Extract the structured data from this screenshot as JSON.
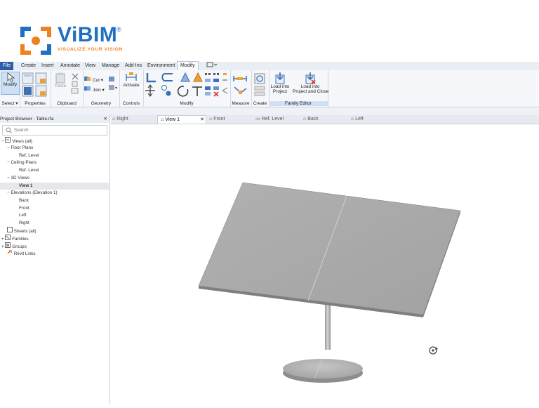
{
  "brand": {
    "name": "ViBIM",
    "reg": "®",
    "tagline": "VISUALIZE YOUR VISION"
  },
  "menu": [
    {
      "label": "File"
    },
    {
      "label": "Create"
    },
    {
      "label": "Insert"
    },
    {
      "label": "Annotate"
    },
    {
      "label": "View"
    },
    {
      "label": "Manage"
    },
    {
      "label": "Add-Ins"
    },
    {
      "label": "Environment"
    },
    {
      "label": "Modify"
    }
  ],
  "ribbon": {
    "select": {
      "modify": "Modify",
      "label": "Select ▾"
    },
    "properties": {
      "label": "Properties"
    },
    "clipboard": {
      "paste": "Paste",
      "label": "Clipboard"
    },
    "geometry": {
      "cut": "Cut",
      "join": "Join",
      "label": "Geometry"
    },
    "controls": {
      "activate": "Activate",
      "label": "Controls"
    },
    "modify": {
      "label": "Modify"
    },
    "measure": {
      "label": "Measure"
    },
    "create": {
      "label": "Create"
    },
    "family_editor": {
      "load_project_l1": "Load into",
      "load_project_l2": "Project",
      "load_close_l1": "Load into",
      "load_close_l2": "Project and Close",
      "label": "Family Editor"
    }
  },
  "project_browser": {
    "title": "Project Browser - Table.rfa",
    "close": "✕",
    "search_placeholder": "Search",
    "tree": [
      {
        "label": "Views (all)"
      },
      {
        "label": "Floor Plans"
      },
      {
        "label": "Ref. Level"
      },
      {
        "label": "Ceiling Plans"
      },
      {
        "label": "Ref. Level"
      },
      {
        "label": "3D Views"
      },
      {
        "label": "View 1"
      },
      {
        "label": "Elevations (Elevation 1)"
      },
      {
        "label": "Back"
      },
      {
        "label": "Front"
      },
      {
        "label": "Left"
      },
      {
        "label": "Right"
      },
      {
        "label": "Sheets (all)"
      },
      {
        "label": "Families"
      },
      {
        "label": "Groups"
      },
      {
        "label": "Revit Links"
      }
    ]
  },
  "view_tabs": [
    {
      "label": "Right"
    },
    {
      "label": "View 1",
      "close": "✕"
    },
    {
      "label": "Front"
    },
    {
      "label": "Ref. Level"
    },
    {
      "label": "Back"
    },
    {
      "label": "Left"
    }
  ],
  "colors": {
    "accent_blue": "#1f6fc2",
    "accent_orange": "#f0801f",
    "table_gray": "#a8a8a8"
  }
}
